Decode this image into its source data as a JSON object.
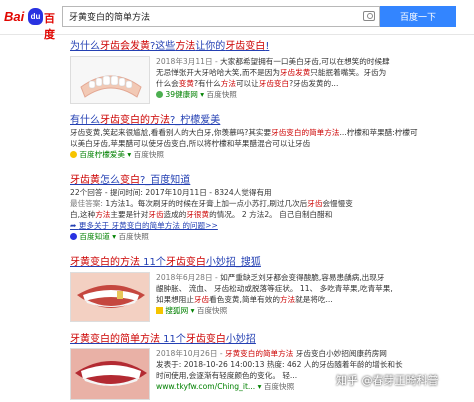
{
  "header": {
    "logo_bai": "Bai",
    "logo_paw": "du",
    "logo_du": "百度",
    "search_query": "牙黄变白的简单方法",
    "search_button": "百度一下"
  },
  "results": [
    {
      "title_pre": "为什么",
      "title_hl1": "牙齿会发黄",
      "title_mid": "?这些",
      "title_hl2": "方法",
      "title_mid2": "让你的",
      "title_hl3": "牙齿变白",
      "title_post": "!",
      "date": "2018年3月11日 - ",
      "desc1": "大家都希望拥有一口美白牙齿,可以在想笑的时候肆",
      "desc2_pre": "无忌惮张开大牙哈哈大笑,而不是因为",
      "desc2_hl": "牙齿发黄",
      "desc2_post": "只能抿着嘴笑。",
      "desc2_tail": "牙齿为",
      "desc3_pre": "什么会",
      "desc3_hl1": "变黄",
      "desc3_mid": "?有什么",
      "desc3_hl2": "方法",
      "desc3_mid2": "可以让",
      "desc3_hl3": "牙齿变白",
      "desc3_post": "?牙齿发黄的...",
      "source": "39健康网",
      "snapshot": "百度快照"
    },
    {
      "title_pre": "有什么",
      "title_hl": "牙齿变白的方法",
      "title_post": "?_柠檬爱美",
      "desc1_pre": "牙齿变黄,笑起来很尴尬,看看别人的大白牙,你羡慕吗?其实要",
      "desc1_hl": "牙齿变白的简单方法",
      "desc1_post": "...柠檬和苹果醋:柠檬可",
      "desc2": "以美白牙齿,苹果醋可以使牙齿变白,所以将柠檬和苹果醋混合可以让牙齿",
      "source": "百度柠檬爱美",
      "snapshot": "百度快照"
    },
    {
      "title_pre": "牙齿黄",
      "title_mid": "怎么",
      "title_hl": "变白",
      "title_post": "?_百度知道",
      "meta": "22个回答 - 提问时间: 2017年10月11日 - 8324人觉得有用",
      "best_label": "最佳答案: ",
      "best1_pre": "1方法1。每次刷牙的时候在牙膏上加一点小苏打,刷过几次后",
      "best1_hl": "牙齿",
      "best1_post": "会慢慢变",
      "best2_pre": "白,这种",
      "best2_hl": "方法",
      "best2_mid": "主要是针对",
      "best2_hl2": "牙齿",
      "best2_mid2": "造成的",
      "best2_hl3": "牙很黄",
      "best2_post": "的情况。 2 方法2。 自己自制白醋和",
      "more": "更多关于 牙黄变白的简单方法 的问题>>",
      "source": "百度知道",
      "snapshot": "百度快照"
    },
    {
      "title_hl1": "牙黄变白的方法",
      "title_mid": " 11个",
      "title_hl2": "牙齿变白",
      "title_post": "小妙招_搜狐",
      "date": "2018年6月28日 - ",
      "desc1": "如严重缺乏刘牙都会变得酸脆,容易患龋病,出现牙",
      "desc2": "龈肿胀、 流血、 牙齿松动或脱落等症状。 11、 多吃青苹果,吃青苹果,",
      "desc3_pre": "如果想阻止",
      "desc3_hl1": "牙齿",
      "desc3_mid": "看色变黄,简单有效的",
      "desc3_hl2": "方法",
      "desc3_post": "就是将吃...",
      "source": "搜狐网",
      "snapshot": "百度快照"
    },
    {
      "title_hl1": "牙黄变白的简单方法",
      "title_mid": " 11个",
      "title_hl2": "牙齿变白",
      "title_post": "小妙招",
      "date": "2018年10月26日 - ",
      "desc1_hl": "牙黄变白的简单方法",
      "desc1_post": " 牙齿变白小妙招阅康药房网",
      "desc2": "发表于: 2018-10-26 14:00:13 热度: 462 人的牙齿随着年龄的增长和长",
      "desc3": "时间使用,会逐渐有轻度颜色的变化。 轻...",
      "source": "www.tkyfw.com/Ching_it...",
      "snapshot": "百度快照"
    }
  ],
  "watermark": "知乎 @春芽正畸科普"
}
